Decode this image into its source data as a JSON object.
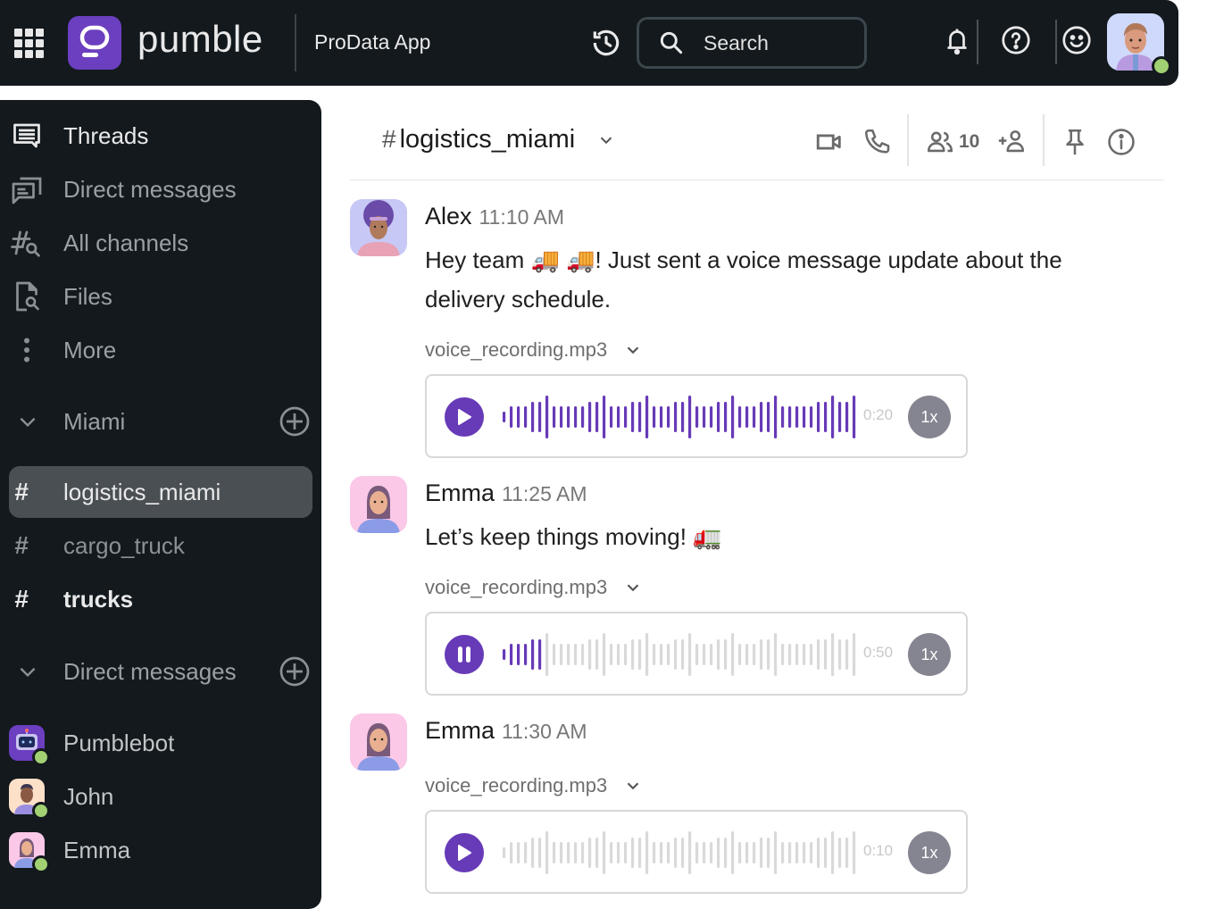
{
  "topbar": {
    "brand": "pumble",
    "workspace": "ProData App",
    "search_placeholder": "Search",
    "colors": {
      "brand": "#6b3fbf",
      "online": "#a2d173"
    }
  },
  "sidebar": {
    "nav": [
      {
        "label": "Threads",
        "icon": "threads-icon"
      },
      {
        "label": "Direct messages",
        "icon": "direct-messages-icon"
      },
      {
        "label": "All channels",
        "icon": "channel-search-icon"
      },
      {
        "label": "Files",
        "icon": "file-search-icon"
      },
      {
        "label": "More",
        "icon": "more-vertical-icon"
      }
    ],
    "sections": {
      "channels_title": "Miami",
      "dm_title": "Direct messages"
    },
    "channels": [
      {
        "name": "logistics_miami",
        "state": "active"
      },
      {
        "name": "cargo_truck",
        "state": "muted"
      },
      {
        "name": "trucks",
        "state": "unread"
      }
    ],
    "dms": [
      {
        "name": "Pumblebot",
        "status": "online"
      },
      {
        "name": "John",
        "status": "online"
      },
      {
        "name": "Emma",
        "status": "online"
      }
    ]
  },
  "channel": {
    "hash": "#",
    "name": "logistics_miami",
    "member_count": "10"
  },
  "messages": [
    {
      "author": "Alex",
      "time": "11:10 AM",
      "text": "Hey team 🚚 🚚! Just sent a voice message update about the delivery schedule.",
      "attachment": {
        "file_name": "voice_recording.mp3",
        "duration": "0:20",
        "speed": "1x",
        "state": "paused",
        "progress": 1.0
      }
    },
    {
      "author": "Emma",
      "time": "11:25 AM",
      "text": "Let’s keep things moving! 🚛",
      "attachment": {
        "file_name": "voice_recording.mp3",
        "duration": "0:50",
        "speed": "1x",
        "state": "playing",
        "progress": 0.12
      }
    },
    {
      "author": "Emma",
      "time": "11:30 AM",
      "text": "",
      "attachment": {
        "file_name": "voice_recording.mp3",
        "duration": "0:10",
        "speed": "1x",
        "state": "paused",
        "progress": 0.0
      }
    }
  ],
  "waveform_levels": [
    1,
    2,
    2,
    2,
    3,
    3,
    4,
    2,
    2,
    2,
    2,
    2,
    3,
    3,
    4,
    2,
    2,
    2,
    3,
    3,
    4,
    2,
    2,
    2,
    3,
    3,
    4,
    2,
    2,
    2,
    3,
    3,
    4,
    2,
    2,
    2,
    3,
    3,
    4,
    2,
    2,
    2,
    2,
    2,
    3,
    3,
    4,
    3,
    3,
    4
  ],
  "waveform_colors": {
    "played": "#673ab7",
    "unplayed": "#d9d9d9"
  }
}
